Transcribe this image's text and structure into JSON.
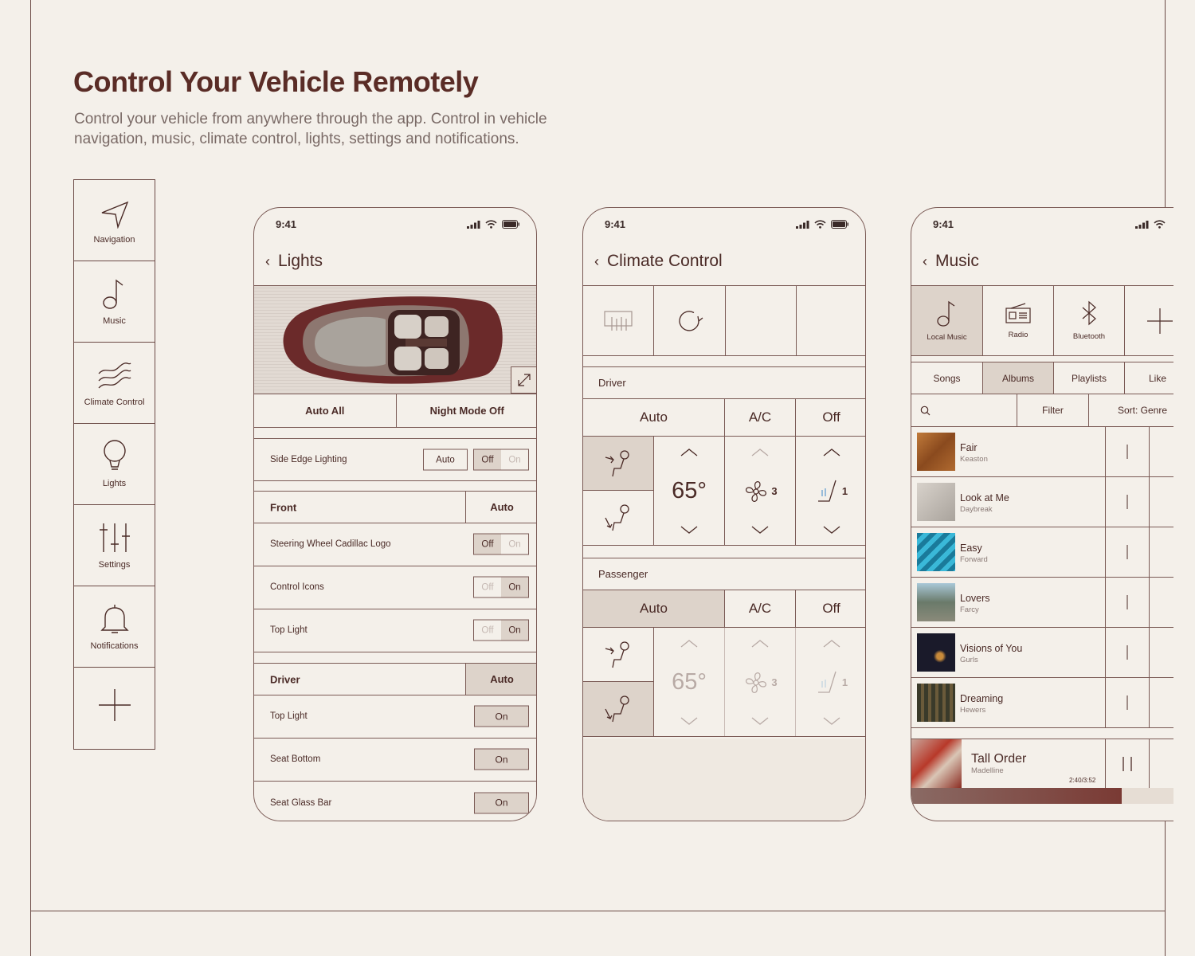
{
  "heading": {
    "title": "Control Your Vehicle Remotely",
    "subtitle": "Control your vehicle from anywhere through the app. Control in vehicle navigation, music, climate control, lights, settings and notifications."
  },
  "sidenav": [
    {
      "label": "Navigation",
      "icon": "navigation-arrow-icon"
    },
    {
      "label": "Music",
      "icon": "music-note-icon"
    },
    {
      "label": "Climate Control",
      "icon": "climate-waves-icon"
    },
    {
      "label": "Lights",
      "icon": "lightbulb-icon"
    },
    {
      "label": "Settings",
      "icon": "sliders-icon"
    },
    {
      "label": "Notifications",
      "icon": "bell-icon"
    },
    {
      "label": "",
      "icon": "plus-icon"
    }
  ],
  "lights": {
    "time": "9:41",
    "title": "Lights",
    "buttons": [
      "Auto All",
      "Night Mode Off"
    ],
    "side_edge": {
      "label": "Side Edge Lighting",
      "auto": "Auto",
      "off": "Off",
      "on": "On"
    },
    "front": {
      "label": "Front",
      "mode": "Auto"
    },
    "front_rows": [
      {
        "label": "Steering Wheel Cadillac Logo",
        "off": "Off",
        "on": "On",
        "active": "off"
      },
      {
        "label": "Control Icons",
        "off": "Off",
        "on": "On",
        "active": "on"
      },
      {
        "label": "Top Light",
        "off": "Off",
        "on": "On",
        "active": "on"
      }
    ],
    "driver": {
      "label": "Driver",
      "mode": "Auto"
    },
    "driver_rows": [
      {
        "label": "Top Light",
        "value": "On"
      },
      {
        "label": "Seat Bottom",
        "value": "On"
      },
      {
        "label": "Seat Glass Bar",
        "value": "On"
      }
    ]
  },
  "climate": {
    "time": "9:41",
    "title": "Climate Control",
    "driver": {
      "label": "Driver",
      "modes": [
        "Auto",
        "A/C",
        "Off"
      ],
      "active_mode": "none",
      "temp": "65°",
      "fan": "3",
      "seat_heat": "1"
    },
    "passenger": {
      "label": "Passenger",
      "modes": [
        "Auto",
        "A/C",
        "Off"
      ],
      "active_mode": "Auto",
      "temp": "65°",
      "fan": "3",
      "seat_heat": "1"
    }
  },
  "music": {
    "time": "9:41",
    "title": "Music",
    "sources": [
      {
        "label": "Local Music",
        "icon": "music-note-icon",
        "active": true
      },
      {
        "label": "Radio",
        "icon": "radio-icon",
        "active": false
      },
      {
        "label": "Bluetooth",
        "icon": "bluetooth-icon",
        "active": false
      },
      {
        "label": "",
        "icon": "plus-icon",
        "active": false
      }
    ],
    "tabs": [
      {
        "label": "Songs",
        "active": false
      },
      {
        "label": "Albums",
        "active": true
      },
      {
        "label": "Playlists",
        "active": false
      },
      {
        "label": "Like",
        "active": false
      }
    ],
    "filter": "Filter",
    "sort": "Sort: Genre",
    "songs": [
      {
        "title": "Fair",
        "artist": "Keaston",
        "art": "#a0622e"
      },
      {
        "title": "Look at Me",
        "artist": "Daybreak",
        "art": "#bdb8b2"
      },
      {
        "title": "Easy",
        "artist": "Forward",
        "art": "#2a9ab8"
      },
      {
        "title": "Lovers",
        "artist": "Farcy",
        "art": "#7a8a86"
      },
      {
        "title": "Visions of You",
        "artist": "Gurls",
        "art": "#1a1a22"
      },
      {
        "title": "Dreaming",
        "artist": "Hewers",
        "art": "#4a4a3a"
      }
    ],
    "now_playing": {
      "title": "Tall Order",
      "artist": "Madelline",
      "time": "2:40/3:52",
      "progress": 0.8
    }
  }
}
